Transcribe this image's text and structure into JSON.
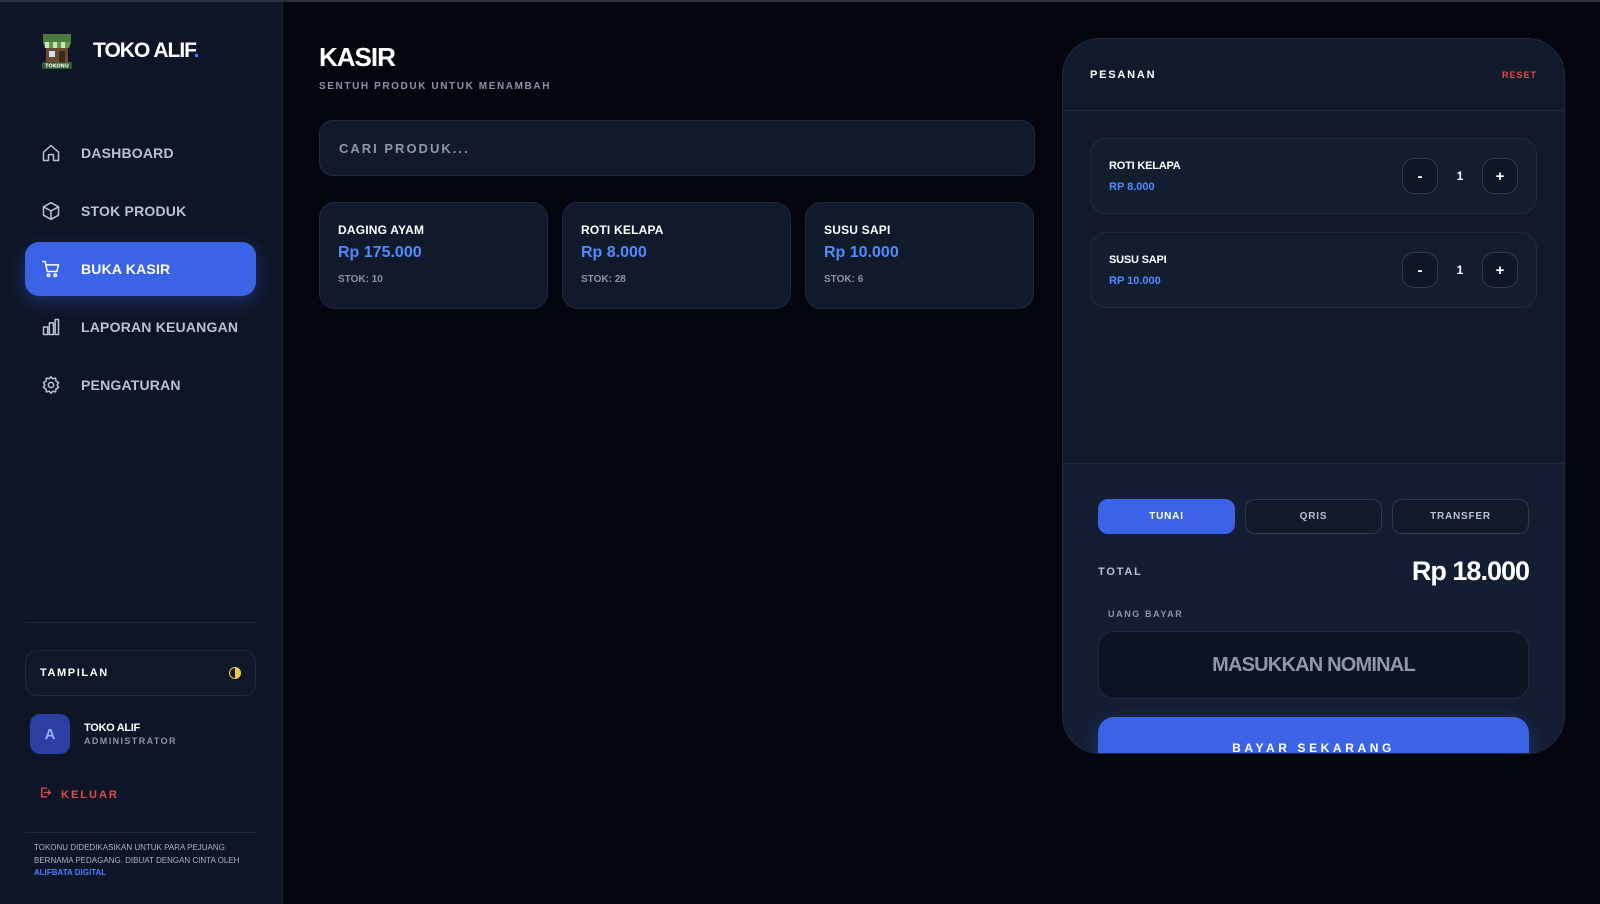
{
  "brand": {
    "name": "TOKO ALIF",
    "dot": ".",
    "logo_text": "TOKONU"
  },
  "nav": {
    "items": [
      {
        "label": "DASHBOARD",
        "icon": "home-icon"
      },
      {
        "label": "STOK PRODUK",
        "icon": "box-icon"
      },
      {
        "label": "BUKA KASIR",
        "icon": "cart-icon",
        "active": true
      },
      {
        "label": "LAPORAN KEUANGAN",
        "icon": "bar-chart-icon"
      },
      {
        "label": "PENGATURAN",
        "icon": "gear-icon"
      }
    ]
  },
  "theme": {
    "label": "TAMPILAN",
    "icon": "half-moon-icon"
  },
  "profile": {
    "initial": "A",
    "name": "TOKO ALIF",
    "role": "ADMINISTRATOR"
  },
  "logout": {
    "label": "KELUAR",
    "icon": "logout-icon"
  },
  "footer": {
    "text": "TOKONU DIDEDIKASIKAN UNTUK PARA PEJUANG BERNAMA PEDAGANG. DIBUAT DENGAN CINTA OLEH",
    "link": "ALIFBATA DIGITAL"
  },
  "main": {
    "title": "KASIR",
    "subtitle": "SENTUH PRODUK UNTUK MENAMBAH",
    "search_placeholder": "CARI PRODUK...",
    "products": [
      {
        "name": "DAGING AYAM",
        "price": "Rp 175.000",
        "stock": "STOK: 10"
      },
      {
        "name": "ROTI KELAPA",
        "price": "Rp 8.000",
        "stock": "STOK: 28"
      },
      {
        "name": "SUSU SAPI",
        "price": "Rp 10.000",
        "stock": "STOK: 6"
      }
    ]
  },
  "order": {
    "title": "PESANAN",
    "reset": "RESET",
    "items": [
      {
        "name": "ROTI KELAPA",
        "price": "RP 8.000",
        "qty": "1",
        "minus": "-",
        "plus": "+"
      },
      {
        "name": "SUSU SAPI",
        "price": "RP 10.000",
        "qty": "1",
        "minus": "-",
        "plus": "+"
      }
    ],
    "payment_methods": [
      {
        "label": "TUNAI",
        "active": true
      },
      {
        "label": "QRIS",
        "active": false
      },
      {
        "label": "TRANSFER",
        "active": false
      }
    ],
    "total_label": "TOTAL",
    "total_value": "Rp 18.000",
    "cash_label": "UANG BAYAR",
    "cash_placeholder": "MASUKKAN NOMINAL",
    "pay_button": "BAYAR SEKARANG"
  },
  "colors": {
    "background": "#03060f",
    "sidebar": "#0d1526",
    "card": "#111a2b",
    "accent": "#3b63e6",
    "price": "#4f8bff",
    "danger": "#e24a4a"
  }
}
